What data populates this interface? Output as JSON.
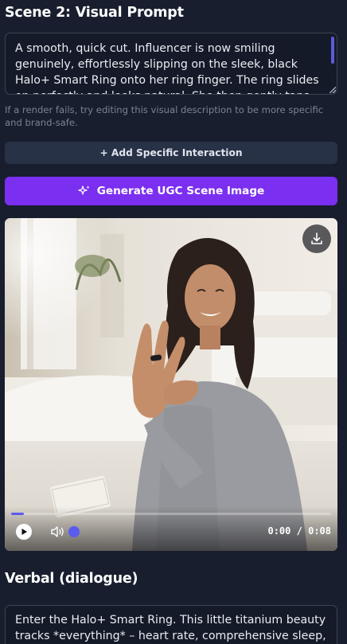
{
  "scene": {
    "title": "Scene 2: Visual Prompt",
    "prompt_text": "A smooth, quick cut. Influencer is now smiling genuinely, effortlessly slipping on the sleek, black Halo+ Smart Ring onto her ring finger. The ring slides on perfectly and looks natural. She then gently taps",
    "hint": "If a render fails, try editing this visual description to be more specific and brand-safe.",
    "add_interaction_label": "+ Add Specific Interaction",
    "generate_label": "Generate UGC Scene Image"
  },
  "player": {
    "current_time": "0:00",
    "separator": "/",
    "duration": "0:08",
    "progress": 0.04,
    "volume_icon": "volume-icon",
    "accent": "#5b5bf0"
  },
  "verbal": {
    "title": "Verbal (dialogue)",
    "dialogue_text": "Enter the Halo+ Smart Ring. This little titanium beauty tracks *everything* – heart rate, comprehensive sleep,"
  },
  "colors": {
    "background": "#181e2e",
    "generate_button": "#7b2ff0",
    "add_button": "#283246"
  }
}
